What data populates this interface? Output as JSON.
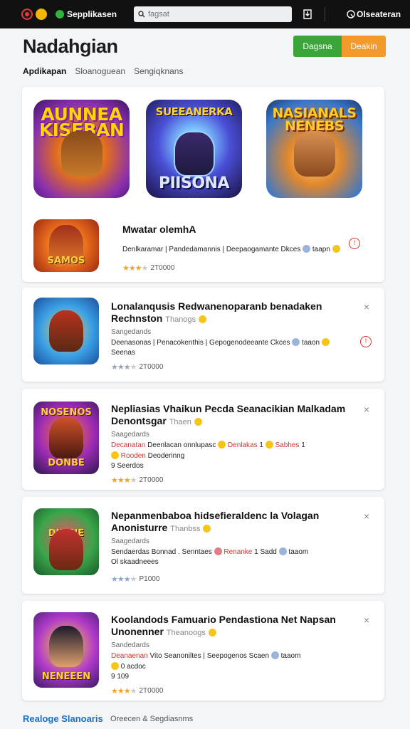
{
  "topbar": {
    "app_label": "Sepplikasen",
    "search_placeholder": "fagsat",
    "account_label": "Olseateran"
  },
  "header": {
    "title": "Nadahgian",
    "btn_green": "Dagsna",
    "btn_orange": "Deakin"
  },
  "tabs": [
    {
      "label": "Apdikapan",
      "active": true
    },
    {
      "label": "Sloanoguean",
      "active": false
    },
    {
      "label": "Sengiqknans",
      "active": false
    }
  ],
  "featured": {
    "tiles": [
      {
        "caption": "AUNNEA KISEBAN"
      },
      {
        "caption_top": "SUEEANERKA",
        "caption_bottom": "PIISONA"
      },
      {
        "caption": "NASIANALS NENEBS"
      }
    ],
    "row": {
      "title": "Mwatar olemhA",
      "meta": "Denlkaramar | Pandedamannis | Deepaogamante Dkces",
      "meta_tail": "taapn",
      "stars": 3,
      "count": "2T0000",
      "icon_caption": "SAMOS"
    }
  },
  "cards": [
    {
      "title": "Lonalanqusis Redwanenoparanb benadaken",
      "title2": "Rechnston",
      "title2_sub": "Thanogs",
      "meta": "Sangedands",
      "line1": "Deenasonas | Penacokenthis | Gepogenodeeante Ckces",
      "line1_tail": "taaon",
      "line2": "Seenas",
      "stars": 2,
      "count": "2T0000",
      "icon_caption": ""
    },
    {
      "title": "Nepliasias Vhaikun Pecda Seanacikian Malkadam",
      "title2": "Denontsgar",
      "title2_sub": "Thaen",
      "meta": "Saagedards",
      "line1_warn": "Decanatan",
      "line1": "Deenlacan onnlupasc",
      "line1_warn2": "Denlakas",
      "line1_mid": "1",
      "line1_warn3": "Sabhes",
      "line1_tail": "1",
      "line2_warn": "Rooden",
      "line2": "Deoderinng",
      "line3": "9 Seerdos",
      "stars": 3,
      "count": "2T0000",
      "icon_caption": "NOSENOS",
      "icon_caption_bottom": "DONBE"
    },
    {
      "title": "Nepanmenbaboa hidsefieraldenc la Volagan",
      "title2": "Anonisturre",
      "title2_sub": "Thanbss",
      "meta": "Saagedards",
      "line1": "Sendaerdas Bonnad . Senntaes",
      "line1_warn": "Renanke",
      "line1_mid": "1 Sadd",
      "line1_tail": "taaom",
      "line2": "Ol skaadneees",
      "stars": 3,
      "count": "P1000",
      "icon_caption": "DIRINE"
    },
    {
      "title": "Koolandods Famuario Pendastiona Net Napsan",
      "title2": "Unonenner",
      "title2_sub": "Theanoogs",
      "meta": "Sandedards",
      "line1_warn": "Deanaenan",
      "line1": "Vito Seanoniltes | Seepogenos Scaen",
      "line1_tail": "taaom",
      "line2": "0 acdoc",
      "line3": "9 109",
      "stars": 3,
      "count": "2T0000",
      "icon_caption": "NENEEEN"
    }
  ],
  "footer": {
    "link": "Realoge Slanoaris",
    "text": "Oreecen & Segdiasnms"
  },
  "colors": {
    "accent_green": "#3aa63a",
    "accent_orange": "#f39a2c",
    "link_blue": "#1b6fc9",
    "warn_red": "#d9302c",
    "star": "#f0a51e"
  }
}
